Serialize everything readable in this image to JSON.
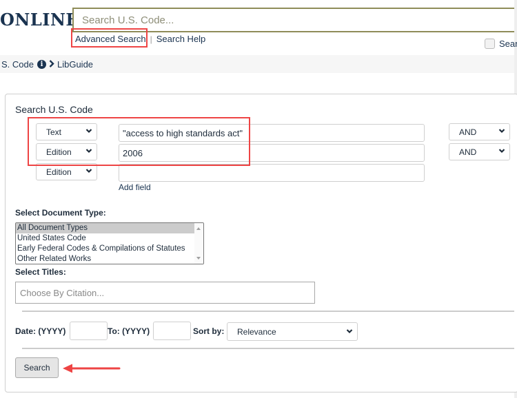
{
  "header": {
    "logo_text": "ONLINE",
    "search_placeholder": "Search U.S. Code...",
    "search_value": "",
    "links": {
      "advanced_search": "Advanced Search",
      "separator": "|",
      "search_help": "Search Help"
    },
    "checkbox_label": "Sear",
    "checkbox_checked": false
  },
  "breadcrumb": {
    "items": [
      "S. Code",
      "LibGuide"
    ],
    "info_icon": "info-circle-icon",
    "chevron_icon": "chevron-right-icon"
  },
  "form": {
    "title": "Search U.S. Code",
    "rows": [
      {
        "field": "Text",
        "value": "\"access to high standards act\"",
        "operator": "AND"
      },
      {
        "field": "Edition",
        "value": "2006",
        "operator": "AND"
      },
      {
        "field": "Edition",
        "value": "",
        "operator": null
      }
    ],
    "add_field_label": "Add field",
    "doc_type_label": "Select Document Type:",
    "doc_types": [
      {
        "label": "All Document Types",
        "selected": true
      },
      {
        "label": "United States Code",
        "selected": false
      },
      {
        "label": "Early Federal Codes & Compilations of Statutes",
        "selected": false
      },
      {
        "label": "Other Related Works",
        "selected": false
      }
    ],
    "titles_label": "Select Titles:",
    "titles_placeholder": "Choose By Citation...",
    "date_from_label": "Date: (YYYY)",
    "date_from_value": "",
    "date_to_label": "To: (YYYY)",
    "date_to_value": "",
    "sort_label": "Sort by:",
    "sort_value": "Relevance",
    "search_button": "Search"
  },
  "annotations": {
    "highlight_color": "#ee4444",
    "arrow_target": "search-button"
  },
  "colors": {
    "brand_navy": "#1a3350",
    "search_border": "#8e8c58",
    "annotation_red": "#ee4444"
  }
}
